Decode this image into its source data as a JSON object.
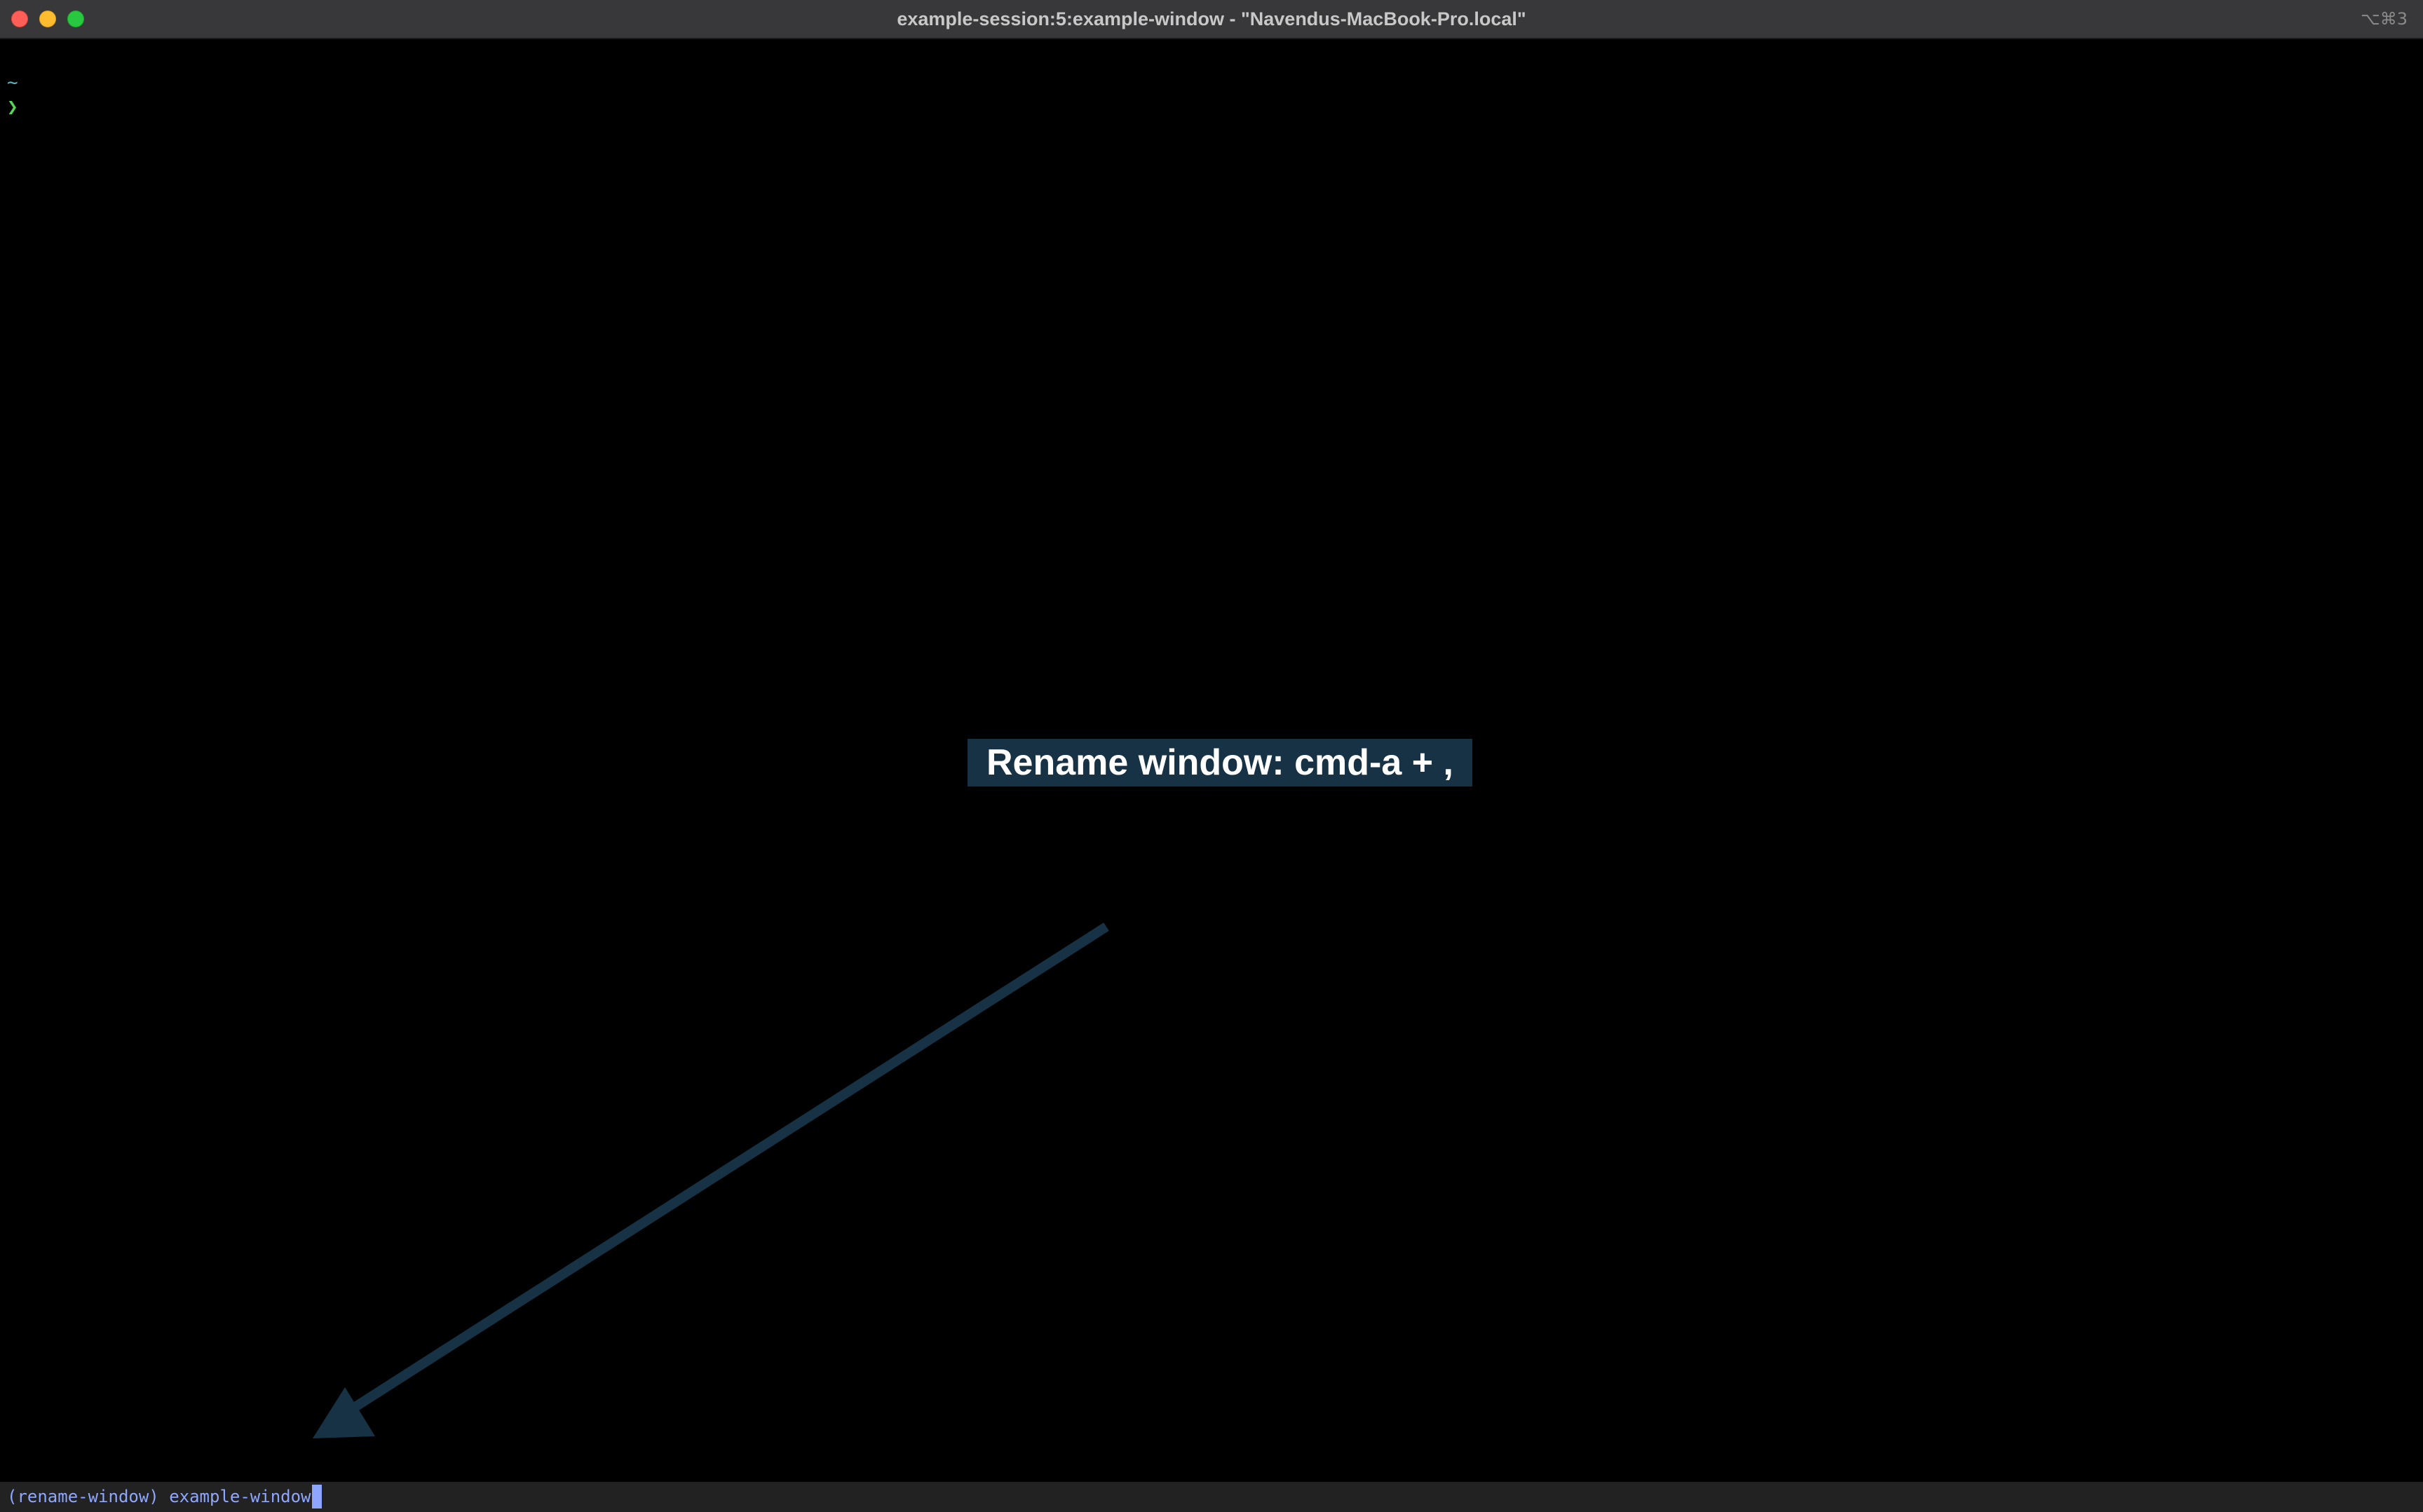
{
  "window": {
    "title": "example-session:5:example-window - \"Navendus-MacBook-Pro.local\"",
    "shortcut": "⌥⌘3"
  },
  "terminal": {
    "cwd": "~",
    "prompt": "❯"
  },
  "annotation": {
    "text": "Rename window: cmd-a + ,"
  },
  "command_prompt": {
    "label": "(rename-window)",
    "value": "example-window"
  },
  "colors": {
    "background": "#000000",
    "titlebar": "#38383a",
    "callout_bg": "#173244",
    "arrow": "#173244",
    "cwd": "#56b6c2",
    "prompt": "#59d45a",
    "command_text": "#8fa6ff"
  },
  "icons": {
    "close": "close-icon",
    "minimize": "minimize-icon",
    "zoom": "zoom-icon"
  }
}
